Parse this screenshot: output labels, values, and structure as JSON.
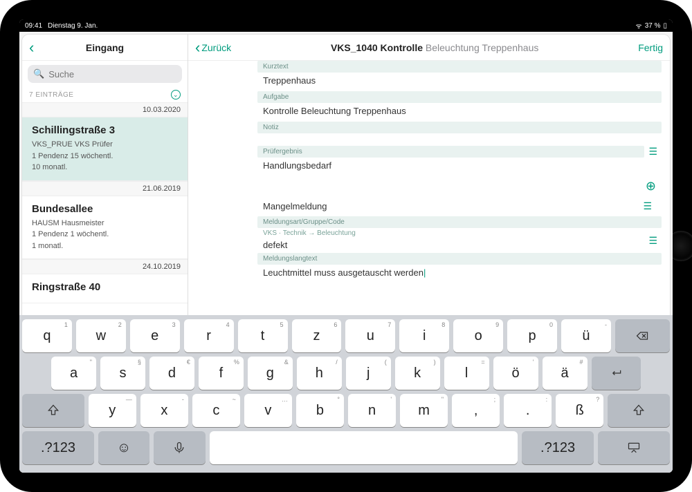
{
  "status": {
    "time": "09:41",
    "date": "Dienstag 9. Jan.",
    "battery": "37 %"
  },
  "sidebar": {
    "title": "Eingang",
    "search_placeholder": "Suche",
    "count_label": "7 EINTRÄGE",
    "items": [
      {
        "date": "10.03.2020",
        "title": "Schillingstraße 3",
        "sub": "VKS_PRUE  VKS Prüfer\n1 Pendenz 15  wöchentl.\n10  monatl."
      },
      {
        "date": "21.06.2019",
        "title": "Bundesallee",
        "sub": "HAUSM       Hausmeister\n1 Pendenz  1  wöchentl.\n1  monatl."
      },
      {
        "date": "24.10.2019",
        "title": "Ringstraße 40",
        "sub": ""
      }
    ]
  },
  "detail": {
    "back_label": "Zurück",
    "title_bold": "VKS_1040 Kontrolle",
    "title_light": "Beleuchtung Treppenhaus",
    "done_label": "Fertig",
    "fields": {
      "kurztext_label": "Kurztext",
      "kurztext_value": "Treppenhaus",
      "aufgabe_label": "Aufgabe",
      "aufgabe_value": "Kontrolle Beleuchtung Treppenhaus",
      "notiz_label": "Notiz",
      "prufergebnis_label": "Prüfergebnis",
      "prufergebnis_value": "Handlungsbedarf",
      "mangelmeldung_label": "Mangelmeldung",
      "meldungsart_label": "Meldungsart/Gruppe/Code",
      "meldungsart_path": "VKS · Technik → Beleuchtung",
      "meldungsart_value": "defekt",
      "meldungslangtext_label": "Meldungslangtext",
      "meldungslangtext_value": "Leuchtmittel muss ausgetauscht werden"
    }
  },
  "keyboard": {
    "row1": [
      {
        "main": "q",
        "sub": "1"
      },
      {
        "main": "w",
        "sub": "2"
      },
      {
        "main": "e",
        "sub": "3"
      },
      {
        "main": "r",
        "sub": "4"
      },
      {
        "main": "t",
        "sub": "5"
      },
      {
        "main": "z",
        "sub": "6"
      },
      {
        "main": "u",
        "sub": "7"
      },
      {
        "main": "i",
        "sub": "8"
      },
      {
        "main": "o",
        "sub": "9"
      },
      {
        "main": "p",
        "sub": "0"
      },
      {
        "main": "ü",
        "sub": "-"
      }
    ],
    "row2": [
      {
        "main": "a",
        "sub": "\""
      },
      {
        "main": "s",
        "sub": "§"
      },
      {
        "main": "d",
        "sub": "€"
      },
      {
        "main": "f",
        "sub": "%"
      },
      {
        "main": "g",
        "sub": "&"
      },
      {
        "main": "h",
        "sub": "/"
      },
      {
        "main": "j",
        "sub": "("
      },
      {
        "main": "k",
        "sub": ")"
      },
      {
        "main": "l",
        "sub": "="
      },
      {
        "main": "ö",
        "sub": "'"
      },
      {
        "main": "ä",
        "sub": "#"
      }
    ],
    "row3": [
      {
        "main": "y",
        "sub": "—"
      },
      {
        "main": "x",
        "sub": "-"
      },
      {
        "main": "c",
        "sub": "~"
      },
      {
        "main": "v",
        "sub": "…"
      },
      {
        "main": "b",
        "sub": "°"
      },
      {
        "main": "n",
        "sub": "'"
      },
      {
        "main": "m",
        "sub": "\""
      },
      {
        "main": ",",
        "sub": ";"
      },
      {
        "main": ".",
        "sub": ":"
      },
      {
        "main": "ß",
        "sub": "?"
      }
    ],
    "numkey": ".?123"
  }
}
